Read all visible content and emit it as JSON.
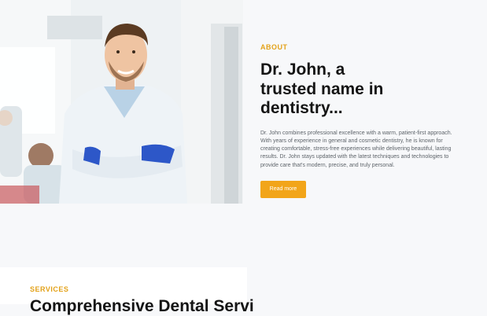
{
  "about": {
    "eyebrow": "ABOUT",
    "headline": "Dr. John, a trusted name in dentistry...",
    "body": "Dr. John combines professional excellence with a warm, patient-first approach. With years of experience in general and cosmetic dentistry, he is known for creating comfortable, stress-free experiences while delivering beautiful, lasting results. Dr. John stays updated with the latest techniques and technologies to provide care that's modern, precise, and truly personal.",
    "cta_label": "Read more",
    "photo_icon": "dentist-portrait-photo"
  },
  "services": {
    "eyebrow": "SERVICES",
    "title": "Comprehensive Dental Servi"
  },
  "colors": {
    "accent": "#f2a51a",
    "eyebrow": "#e3a21a",
    "heading": "#141414",
    "body_text": "#5e646a",
    "page_bg": "#f7f8fa"
  }
}
